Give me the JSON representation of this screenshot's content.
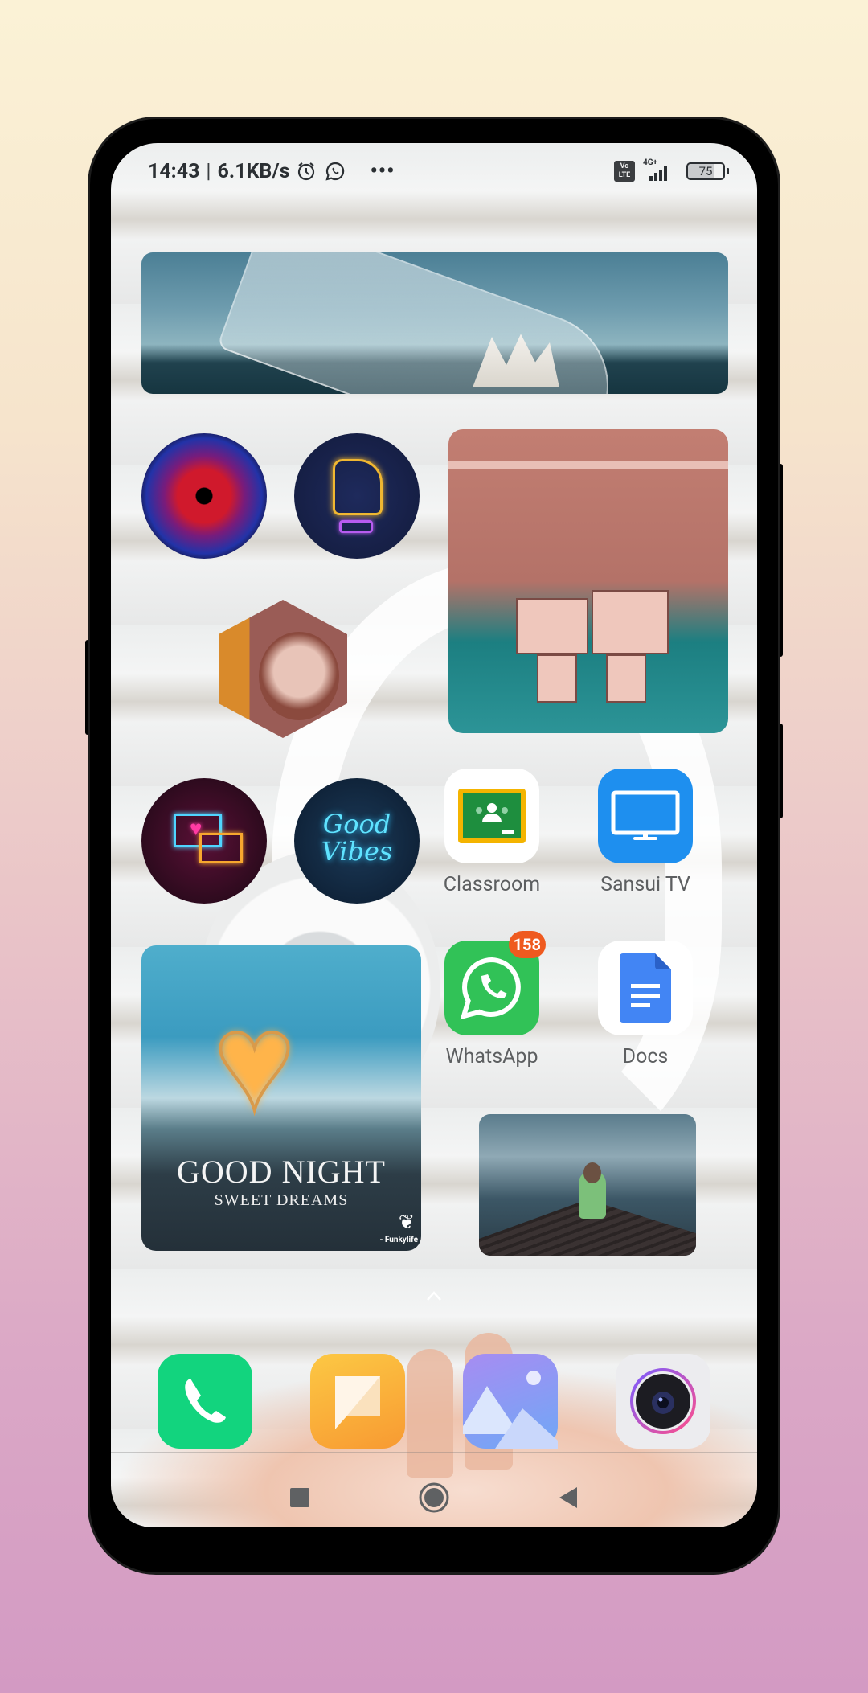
{
  "status_bar": {
    "time": "14:43",
    "separator": "|",
    "net_speed": "6.1KB/s",
    "notification_icons": [
      "alarm-icon",
      "whatsapp-icon"
    ],
    "more_indicator": "•••",
    "volte_label_top": "Vo",
    "volte_label_bottom": "LTE",
    "network_type": "4G+",
    "signal_bars": 4,
    "battery_percent": "75"
  },
  "widgets": [
    {
      "name": "photo-widget-bottle-ship",
      "description": "Ship in a bottle photo"
    },
    {
      "name": "photo-widget-neon-wolf",
      "description": "Neon wolf circle photo"
    },
    {
      "name": "photo-widget-neon-hand",
      "description": "Neon rock hand circle photo"
    },
    {
      "name": "photo-widget-anime-girl",
      "description": "Anime girl hexagon photo"
    },
    {
      "name": "photo-widget-keychains",
      "description": "Couple keychains photo"
    },
    {
      "name": "photo-widget-neon-chat",
      "description": "Neon chat bubbles circle photo"
    },
    {
      "name": "photo-widget-good-vibes",
      "description": "Good Vibes neon circle photo"
    },
    {
      "name": "photo-widget-good-night",
      "description": "Good Night heart photo"
    },
    {
      "name": "photo-widget-pier-girl",
      "description": "Girl on pier photo"
    }
  ],
  "good_vibes_text": "Good Vibes",
  "good_night": {
    "title": "GOOD NIGHT",
    "subtitle": "SWEET DREAMS",
    "credit": "- Funkylife"
  },
  "apps": [
    {
      "label": "Classroom",
      "icon": "google-classroom-icon"
    },
    {
      "label": "Sansui TV",
      "icon": "tv-icon",
      "color": "#1e8fef"
    },
    {
      "label": "WhatsApp",
      "icon": "whatsapp-icon",
      "color": "#31c257",
      "badge": "158",
      "badge_color": "#ef5a1f"
    },
    {
      "label": "Docs",
      "icon": "google-docs-icon",
      "color": "#4285f4"
    }
  ],
  "dock": [
    {
      "name": "phone",
      "icon": "phone-icon",
      "color": "#12d47e"
    },
    {
      "name": "messages",
      "icon": "message-icon",
      "color": "#f8a33a"
    },
    {
      "name": "gallery",
      "icon": "gallery-icon",
      "color": "#8fa2f5"
    },
    {
      "name": "camera",
      "icon": "camera-icon",
      "color": "#eeeeee"
    }
  ],
  "nav": {
    "recents": "recents-icon",
    "home": "home-icon",
    "back": "back-icon"
  }
}
